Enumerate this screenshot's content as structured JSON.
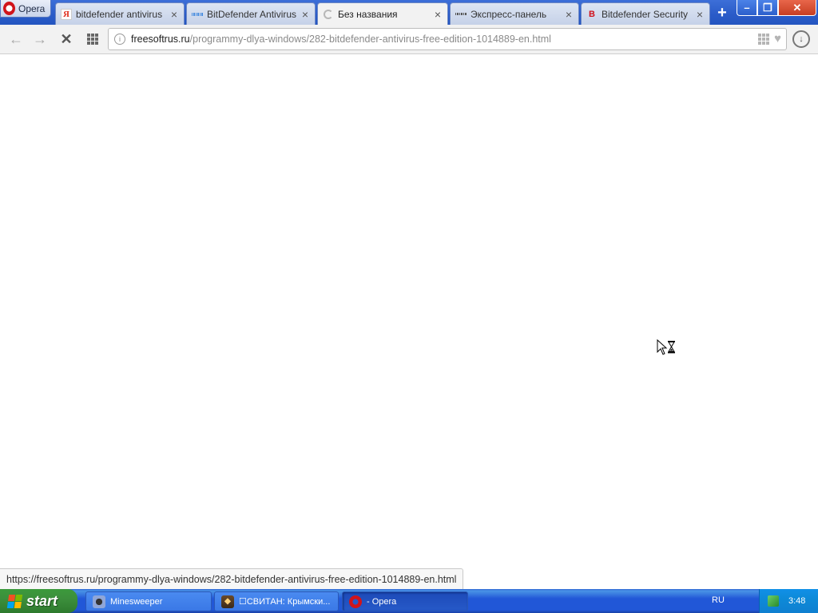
{
  "browser": {
    "menu_label": "Opera",
    "tabs": [
      {
        "label": "bitdefender antivirus",
        "icon": "yandex-icon",
        "favicon_glyph": "Я"
      },
      {
        "label": "BitDefender Antivirus",
        "icon": "grid-favicon-icon"
      },
      {
        "label": "Без названия",
        "icon": "loading-spinner-icon",
        "active": true
      },
      {
        "label": "Экспресс-панель",
        "icon": "speed-dial-icon"
      },
      {
        "label": "Bitdefender Security",
        "icon": "bitdefender-icon",
        "favicon_glyph": "B"
      }
    ],
    "new_tab_glyph": "+",
    "window_controls": {
      "minimize": "–",
      "maximize": "❐",
      "close": "✕"
    }
  },
  "toolbar": {
    "back_glyph": "←",
    "forward_glyph": "→",
    "stop_glyph": "✕",
    "address": {
      "host": "freesoftrus.ru",
      "path": "/programmy-dlya-windows/282-bitdefender-antivirus-free-edition-1014889-en.html"
    },
    "download_glyph": "↓"
  },
  "status": {
    "hover_url": "https://freesoftrus.ru/programmy-dlya-windows/282-bitdefender-antivirus-free-edition-1014889-en.html"
  },
  "taskbar": {
    "start_label": "start",
    "tasks": [
      {
        "label": "Minesweeper",
        "icon": "minesweeper-icon"
      },
      {
        "label": "☐СВИТАН: Крымски...",
        "icon": "svitan-app-icon"
      },
      {
        "label": "- Opera",
        "icon": "opera-icon",
        "active": true
      }
    ],
    "language": "RU",
    "clock": "3:48"
  },
  "colors": {
    "titlebar": "#2a5bc8",
    "taskbar": "#2157d7",
    "start_button": "#3c8f3c",
    "tray": "#0f7fd0"
  }
}
